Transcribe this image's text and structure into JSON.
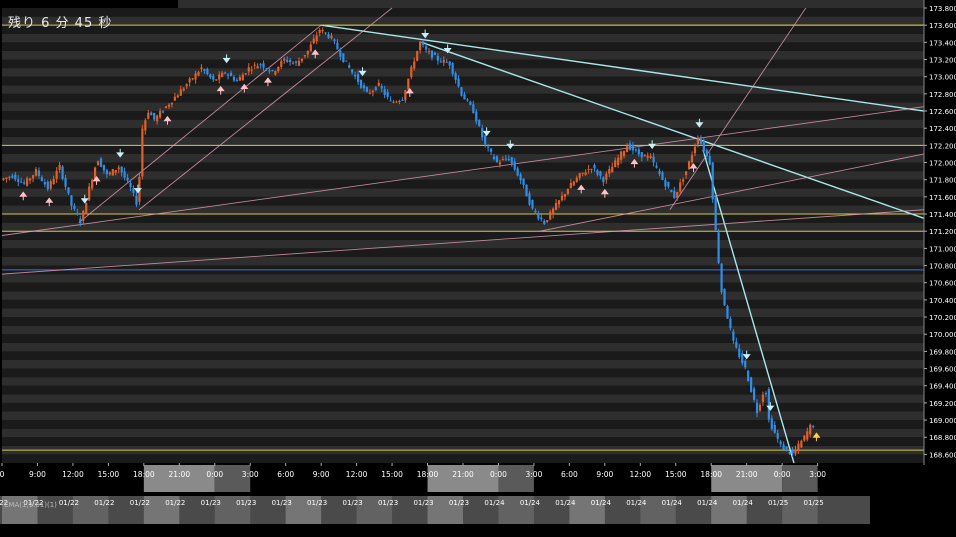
{
  "countdown": "残り 6 分 45 秒",
  "indicator_label": "EMA(1,1.01)(1)",
  "colors": {
    "background": "#000000",
    "band_dark": "#2e2e2e",
    "band_light": "#1a1a1a",
    "up_candle": "#e0602a",
    "down_candle": "#2f8fe8",
    "trend_cyan": "#a8e8ea",
    "support_yellow": "#d8c84a",
    "fan_pink": "#e8a0b8",
    "mid_blue": "#3a6fe0",
    "axis_text": "#ffffff",
    "arrow_up": "#ffc0c8",
    "arrow_down": "#c8f0f8",
    "arrow_last": "#ffd040"
  },
  "chart_data": {
    "type": "candlestick",
    "title": "",
    "ylim": [
      168.5,
      173.8
    ],
    "y_ticks": [
      "173.800",
      "173.600",
      "173.400",
      "173.200",
      "173.000",
      "172.800",
      "172.600",
      "172.400",
      "172.200",
      "172.000",
      "171.800",
      "171.600",
      "171.400",
      "171.200",
      "171.000",
      "170.800",
      "170.600",
      "170.400",
      "170.200",
      "170.000",
      "169.800",
      "169.600",
      "169.400",
      "169.200",
      "169.000",
      "168.800",
      "168.600"
    ],
    "y_tick_values": [
      173.8,
      173.6,
      173.4,
      173.2,
      173.0,
      172.8,
      172.6,
      172.4,
      172.2,
      172.0,
      171.8,
      171.6,
      171.4,
      171.2,
      171.0,
      170.8,
      170.6,
      170.4,
      170.2,
      170.0,
      169.8,
      169.6,
      169.4,
      169.2,
      169.0,
      168.8,
      168.6
    ],
    "x_range_hours": [
      0,
      78
    ],
    "time_ticks": [
      {
        "h": 0,
        "label": "0"
      },
      {
        "h": 3,
        "label": "9:00"
      },
      {
        "h": 6,
        "label": "12:00"
      },
      {
        "h": 9,
        "label": "15:00"
      },
      {
        "h": 12,
        "label": "18:00"
      },
      {
        "h": 15,
        "label": "21:00"
      },
      {
        "h": 18,
        "label": "0:00"
      },
      {
        "h": 21,
        "label": "3:00"
      },
      {
        "h": 24,
        "label": "6:00"
      },
      {
        "h": 27,
        "label": "9:00"
      },
      {
        "h": 30,
        "label": "12:00"
      },
      {
        "h": 33,
        "label": "15:00"
      },
      {
        "h": 36,
        "label": "18:00"
      },
      {
        "h": 39,
        "label": "21:00"
      },
      {
        "h": 42,
        "label": "0:00"
      },
      {
        "h": 45,
        "label": "3:00"
      },
      {
        "h": 48,
        "label": "6:00"
      },
      {
        "h": 51,
        "label": "9:00"
      },
      {
        "h": 54,
        "label": "12:00"
      },
      {
        "h": 57,
        "label": "15:00"
      },
      {
        "h": 60,
        "label": "18:00"
      },
      {
        "h": 63,
        "label": "21:00"
      },
      {
        "h": 66,
        "label": "0:00"
      },
      {
        "h": 69,
        "label": "3:00"
      }
    ],
    "date_ticks": [
      {
        "h": 0,
        "label": "01/22"
      },
      {
        "h": 3,
        "label": "01/22"
      },
      {
        "h": 6,
        "label": "01/22"
      },
      {
        "h": 9,
        "label": "01/22"
      },
      {
        "h": 12,
        "label": "01/22"
      },
      {
        "h": 15,
        "label": "01/22"
      },
      {
        "h": 18,
        "label": "01/23"
      },
      {
        "h": 21,
        "label": "01/23"
      },
      {
        "h": 24,
        "label": "01/23"
      },
      {
        "h": 27,
        "label": "01/23"
      },
      {
        "h": 30,
        "label": "01/23"
      },
      {
        "h": 33,
        "label": "01/23"
      },
      {
        "h": 36,
        "label": "01/23"
      },
      {
        "h": 39,
        "label": "01/23"
      },
      {
        "h": 42,
        "label": "01/24"
      },
      {
        "h": 45,
        "label": "01/24"
      },
      {
        "h": 48,
        "label": "01/24"
      },
      {
        "h": 51,
        "label": "01/24"
      },
      {
        "h": 54,
        "label": "01/24"
      },
      {
        "h": 57,
        "label": "01/24"
      },
      {
        "h": 60,
        "label": "01/24"
      },
      {
        "h": 63,
        "label": "01/24"
      },
      {
        "h": 66,
        "label": "01/25"
      },
      {
        "h": 69,
        "label": "01/25"
      }
    ],
    "price_path": [
      [
        0,
        171.8
      ],
      [
        1,
        171.85
      ],
      [
        2,
        171.75
      ],
      [
        3,
        171.9
      ],
      [
        4,
        171.7
      ],
      [
        5,
        171.95
      ],
      [
        6,
        171.5
      ],
      [
        6.8,
        171.3
      ],
      [
        7.5,
        171.7
      ],
      [
        8.2,
        172.05
      ],
      [
        9,
        171.85
      ],
      [
        10,
        171.95
      ],
      [
        11,
        171.7
      ],
      [
        11.6,
        171.5
      ],
      [
        12,
        172.4
      ],
      [
        12.5,
        172.6
      ],
      [
        13,
        172.5
      ],
      [
        14,
        172.65
      ],
      [
        15,
        172.8
      ],
      [
        16,
        172.95
      ],
      [
        17,
        173.1
      ],
      [
        18,
        172.95
      ],
      [
        19,
        173.05
      ],
      [
        20,
        172.95
      ],
      [
        21,
        173.1
      ],
      [
        22,
        173.15
      ],
      [
        23,
        173.05
      ],
      [
        24,
        173.2
      ],
      [
        25,
        173.15
      ],
      [
        26,
        173.3
      ],
      [
        27,
        173.55
      ],
      [
        28,
        173.45
      ],
      [
        29,
        173.2
      ],
      [
        30,
        173.0
      ],
      [
        31,
        172.8
      ],
      [
        32,
        172.9
      ],
      [
        33,
        172.7
      ],
      [
        34,
        172.75
      ],
      [
        35,
        173.2
      ],
      [
        35.5,
        173.4
      ],
      [
        36,
        173.3
      ],
      [
        37,
        173.2
      ],
      [
        38,
        173.15
      ],
      [
        39,
        172.8
      ],
      [
        40,
        172.6
      ],
      [
        41,
        172.2
      ],
      [
        42,
        172.0
      ],
      [
        43,
        172.05
      ],
      [
        44,
        171.8
      ],
      [
        45,
        171.45
      ],
      [
        46,
        171.3
      ],
      [
        47,
        171.5
      ],
      [
        48,
        171.7
      ],
      [
        49,
        171.85
      ],
      [
        50,
        171.95
      ],
      [
        51,
        171.8
      ],
      [
        52,
        172.0
      ],
      [
        53,
        172.2
      ],
      [
        54,
        172.1
      ],
      [
        55,
        172.05
      ],
      [
        56,
        171.8
      ],
      [
        57,
        171.6
      ],
      [
        58,
        171.9
      ],
      [
        59,
        172.3
      ],
      [
        60,
        172.0
      ],
      [
        60.5,
        171.2
      ],
      [
        61,
        170.5
      ],
      [
        62,
        169.9
      ],
      [
        63,
        169.6
      ],
      [
        64,
        169.1
      ],
      [
        64.7,
        169.4
      ],
      [
        65,
        169.0
      ],
      [
        66,
        168.7
      ],
      [
        67,
        168.6
      ],
      [
        68,
        168.8
      ],
      [
        68.6,
        168.95
      ]
    ],
    "arrows_up_hours": [
      1.8,
      4,
      8,
      14,
      18.5,
      20.5,
      22.5,
      26.5,
      34.5,
      49,
      51,
      53.5,
      58.5
    ],
    "arrows_down_hours": [
      7,
      10,
      11.5,
      19,
      30.5,
      35.8,
      37.7,
      41,
      43,
      55,
      59,
      63,
      65
    ],
    "hlines": [
      {
        "y": 173.6,
        "color": "yellow"
      },
      {
        "y": 172.2,
        "color": "yellow"
      },
      {
        "y": 171.4,
        "color": "yellow"
      },
      {
        "y": 171.2,
        "color": "yellow"
      },
      {
        "y": 170.75,
        "color": "blue"
      },
      {
        "y": 168.65,
        "color": "yellow"
      }
    ],
    "trendlines": [
      {
        "p1": [
          27,
          173.6
        ],
        "p2": [
          78,
          172.6
        ],
        "color": "cyan"
      },
      {
        "p1": [
          35.5,
          173.4
        ],
        "p2": [
          78,
          171.35
        ],
        "color": "cyan"
      },
      {
        "p1": [
          59.3,
          172.15
        ],
        "p2": [
          67,
          168.5
        ],
        "color": "cyan"
      },
      {
        "p1": [
          0,
          171.15
        ],
        "p2": [
          78,
          172.65
        ],
        "color": "pink"
      },
      {
        "p1": [
          0,
          170.7
        ],
        "p2": [
          78,
          171.45
        ],
        "color": "pink"
      },
      {
        "p1": [
          11.6,
          171.45
        ],
        "p2": [
          33,
          173.8
        ],
        "color": "pink"
      },
      {
        "p1": [
          6.5,
          171.3
        ],
        "p2": [
          27,
          173.6
        ],
        "color": "pink"
      },
      {
        "p1": [
          56.5,
          171.45
        ],
        "p2": [
          68,
          173.8
        ],
        "color": "pink"
      },
      {
        "p1": [
          45.5,
          171.2
        ],
        "p2": [
          78,
          172.1
        ],
        "color": "pink"
      },
      {
        "p1": [
          27,
          173.6
        ],
        "p2": [
          78,
          173.6
        ],
        "color": "yellow"
      }
    ]
  }
}
